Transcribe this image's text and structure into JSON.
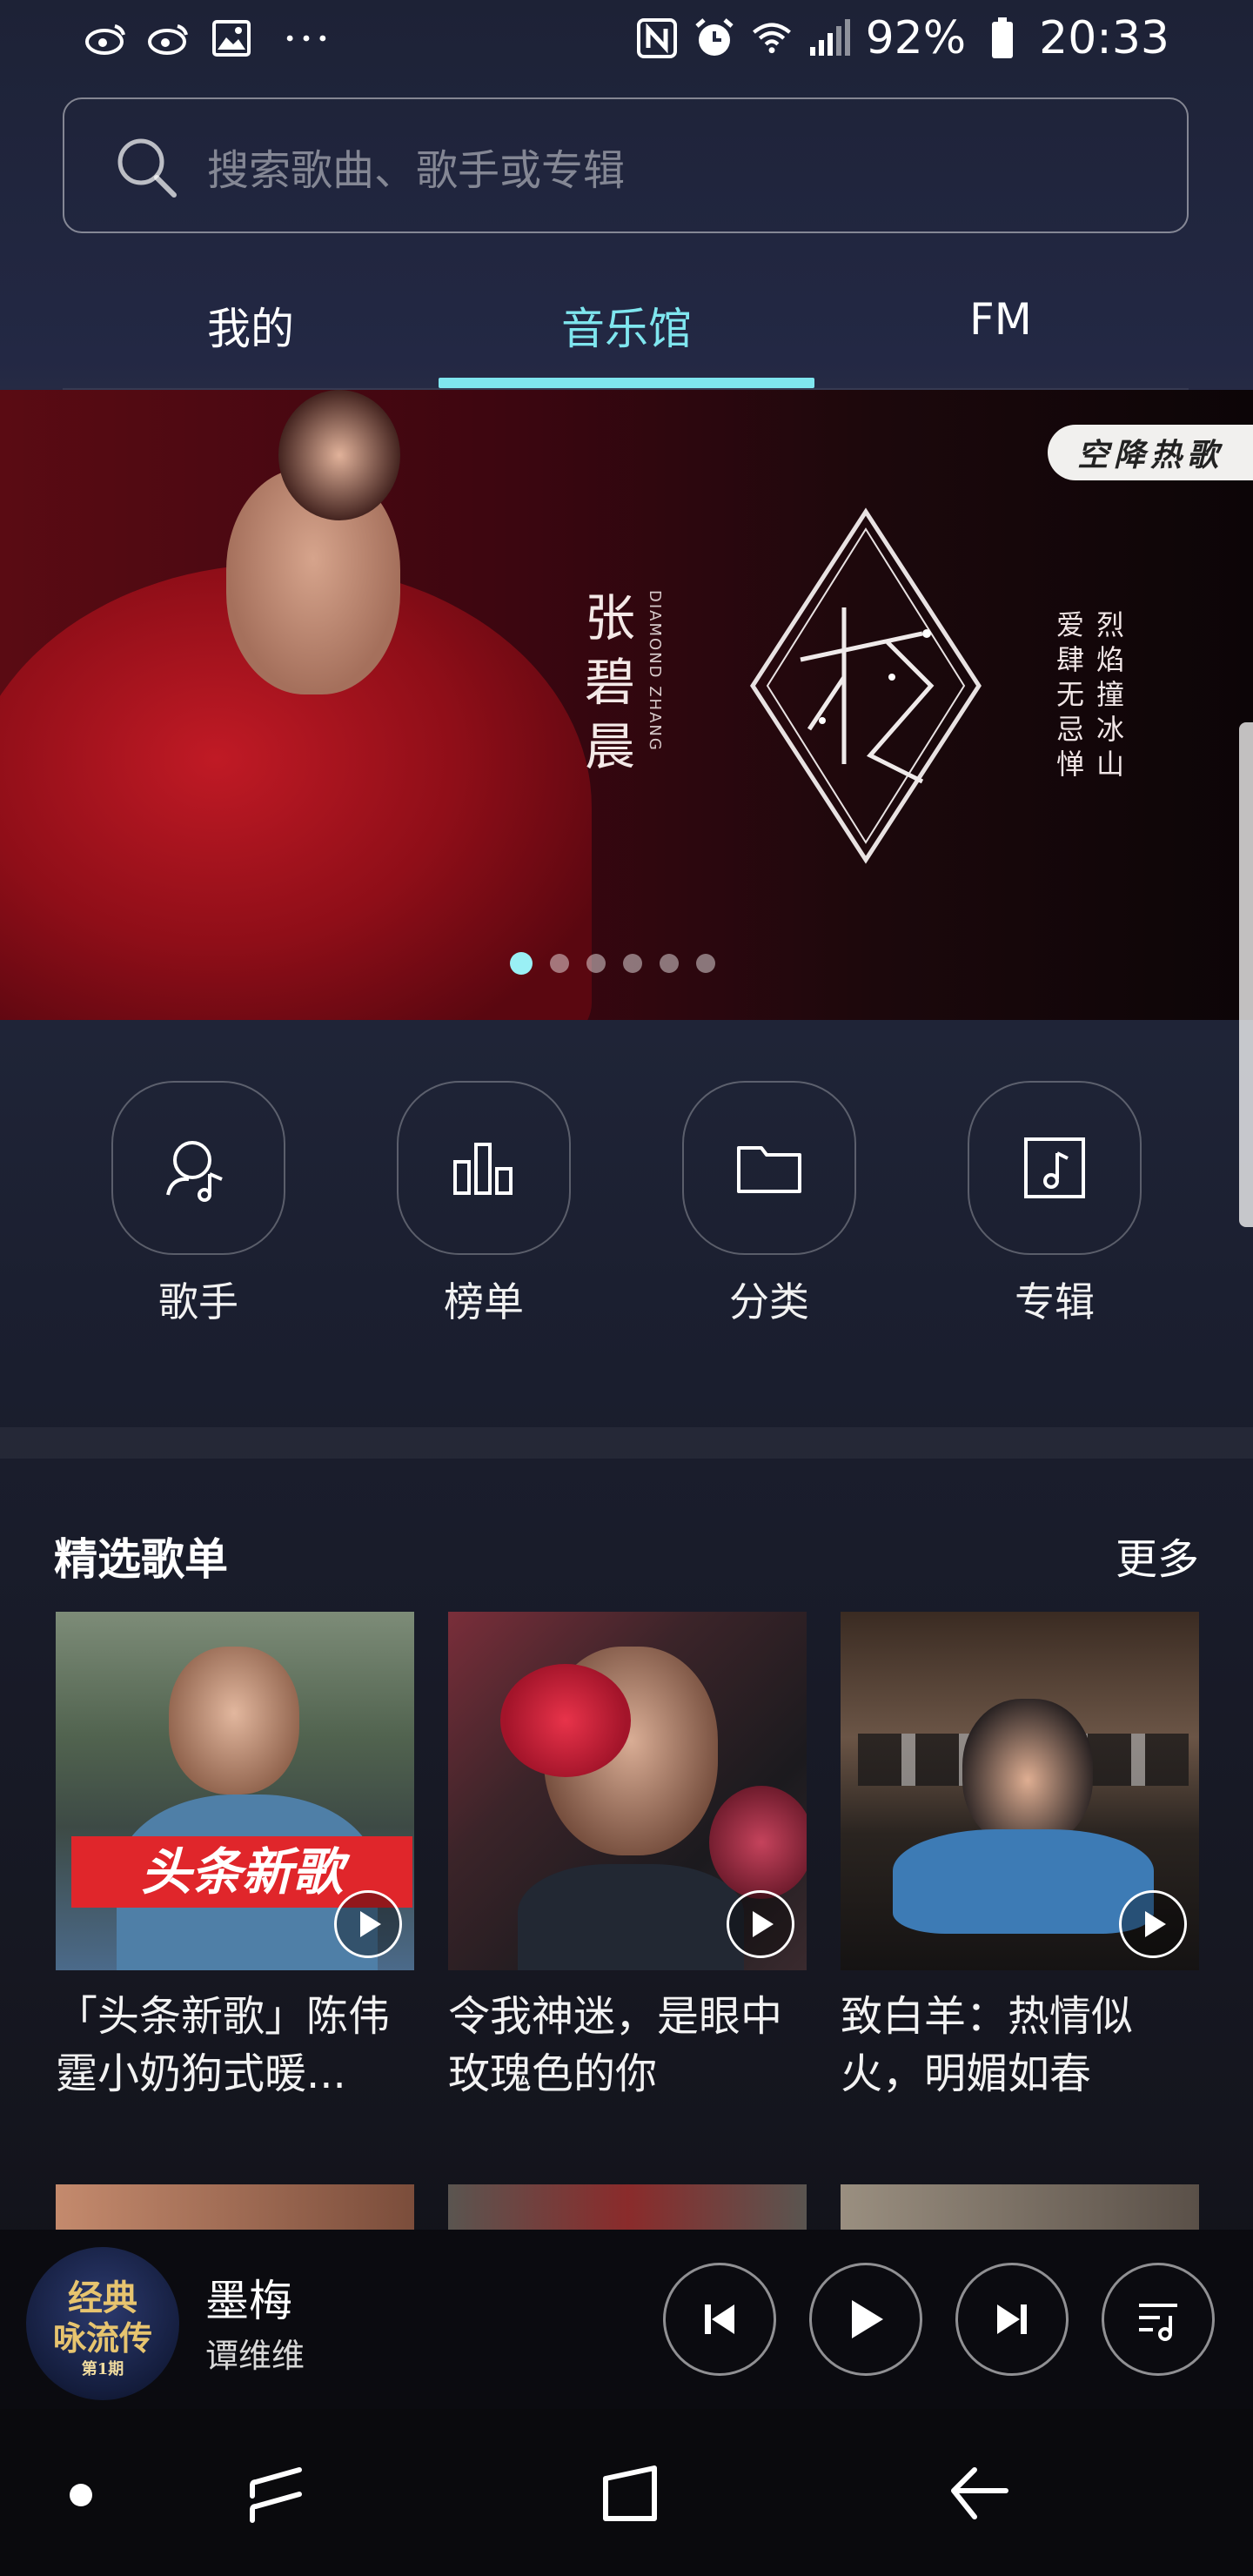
{
  "status_bar": {
    "battery": "92%",
    "time": "20:33",
    "left_icons": [
      "weibo-icon",
      "weibo-icon",
      "gallery-icon",
      "more-icon"
    ],
    "right_icons": [
      "nfc-icon",
      "alarm-icon",
      "wifi-icon",
      "signal-icon",
      "battery-icon"
    ]
  },
  "search": {
    "placeholder": "搜索歌曲、歌手或专辑"
  },
  "tabs": [
    {
      "label": "我的",
      "active": false
    },
    {
      "label": "音乐馆",
      "active": true
    },
    {
      "label": "FM",
      "active": false
    }
  ],
  "accent_color": "#7fe6ef",
  "banner": {
    "artist_cn": "张碧晨",
    "artist_en": "DIAMOND ZHANG",
    "badge": "空降热歌",
    "song_line1": "烈焰撞冰山",
    "song_line2": "爱肆无忌惮",
    "slides": 6,
    "active_slide": 1
  },
  "quick_nav": [
    {
      "label": "歌手",
      "icon": "singer-icon"
    },
    {
      "label": "榜单",
      "icon": "chart-icon"
    },
    {
      "label": "分类",
      "icon": "folder-icon"
    },
    {
      "label": "专辑",
      "icon": "album-icon"
    }
  ],
  "section": {
    "title": "精选歌单",
    "more": "更多",
    "playlists": [
      {
        "title": "「头条新歌」陈伟霆小奶狗式暖...",
        "thumb_text": "头条新歌"
      },
      {
        "title": "令我神迷，是眼中玫瑰色的你"
      },
      {
        "title": "致白羊：热情似火，明媚如春"
      }
    ]
  },
  "player": {
    "song": "墨梅",
    "artist": "谭维维",
    "cover_line1": "经典",
    "cover_line2": "咏流传",
    "cover_line3": "第1期"
  }
}
